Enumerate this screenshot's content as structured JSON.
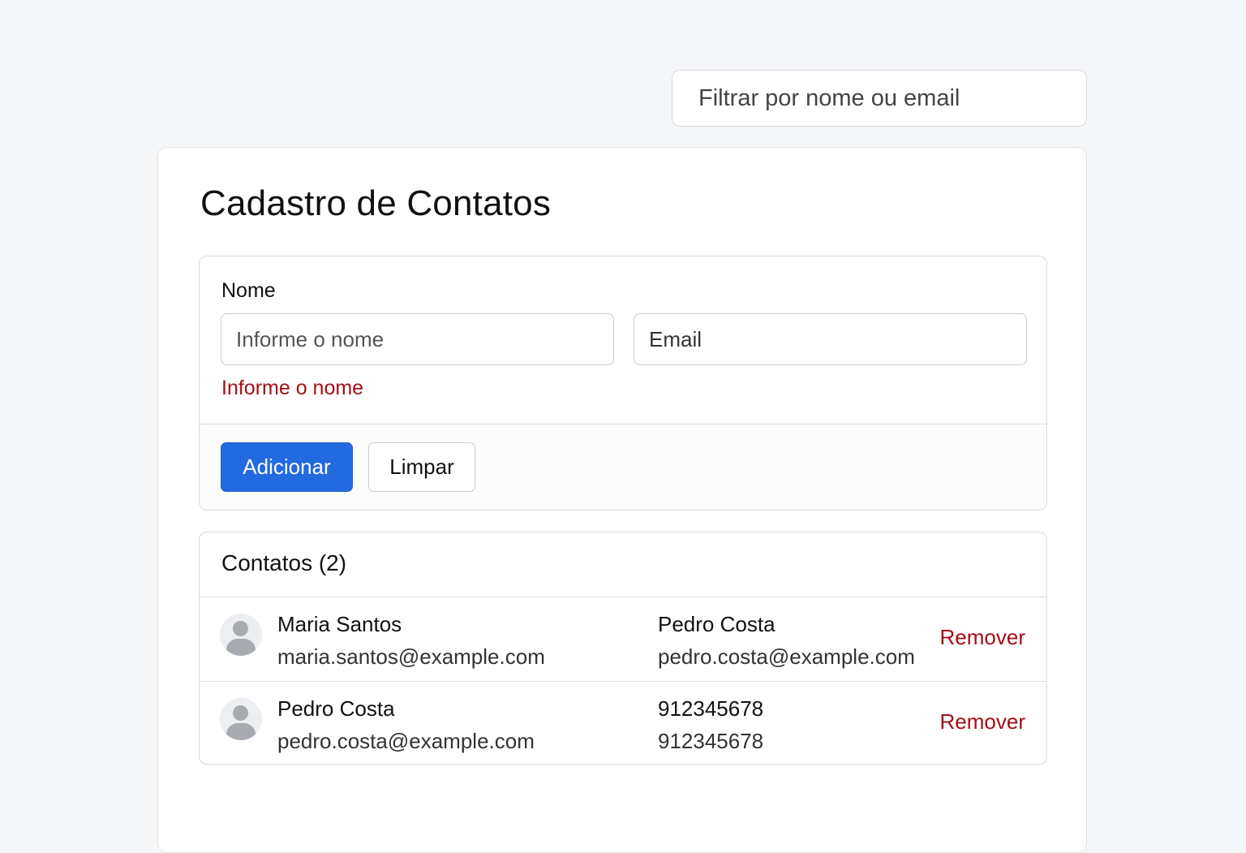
{
  "filter": {
    "placeholder": "Filtrar por nome ou email"
  },
  "page": {
    "title": "Cadastro de Contatos"
  },
  "form": {
    "name_label": "Nome",
    "name_placeholder": "Informe o nome",
    "email_placeholder": "Email",
    "error_text": "Informe o nome",
    "add_button": "Adicionar",
    "clear_button": "Limpar"
  },
  "list": {
    "title": "Contatos (2)",
    "rows": [
      {
        "name": "Maria Santos",
        "email": "maria.santos@example.com",
        "col2_primary": "Pedro Costa",
        "col2_secondary": "pedro.costa@example.com",
        "action": "Remover",
        "avatar_icon": "user-avatar-icon"
      },
      {
        "name": "Pedro Costa",
        "email": "pedro.costa@example.com",
        "col2_primary": "912345678",
        "col2_secondary": "912345678",
        "action": "Remover",
        "avatar_icon": "user-avatar-icon"
      }
    ]
  },
  "colors": {
    "primary": "#2369e0",
    "danger": "#a30f15",
    "background": "#f5f6f8"
  }
}
